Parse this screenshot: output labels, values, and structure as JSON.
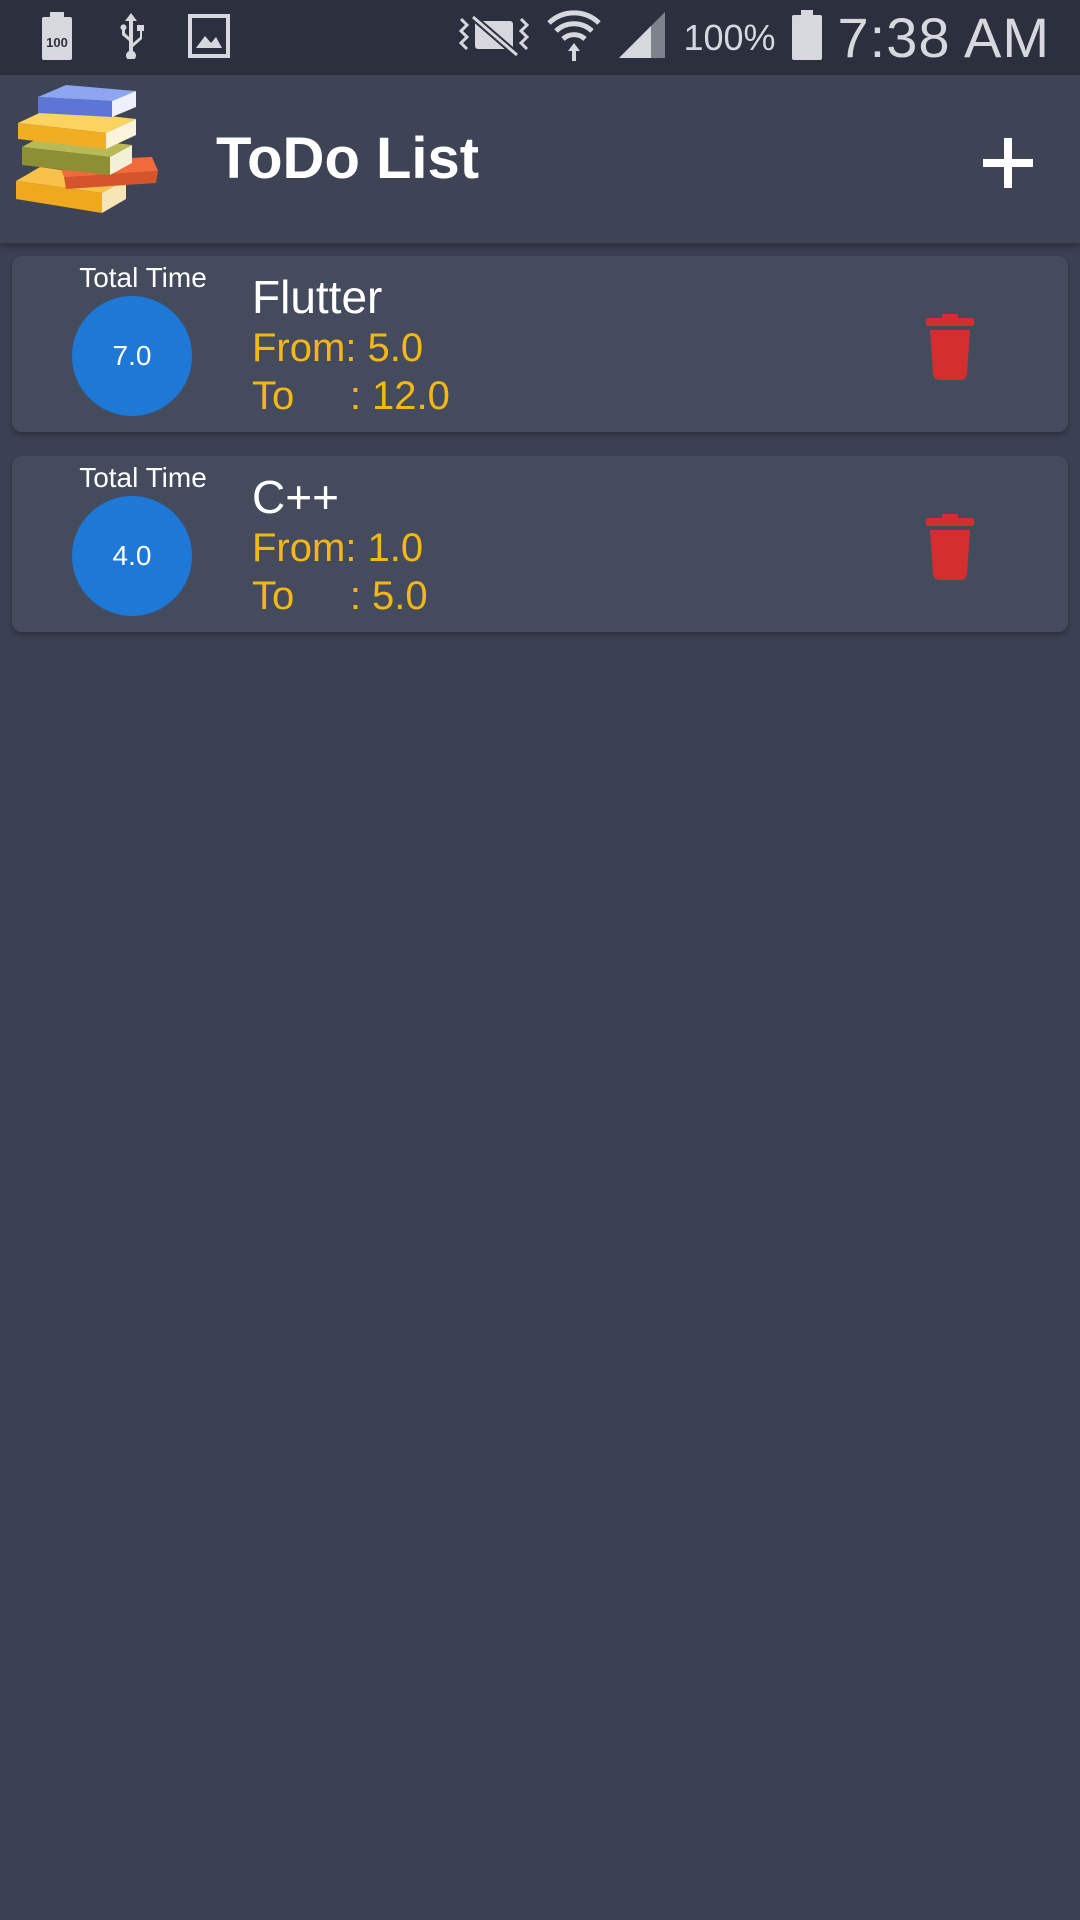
{
  "status_bar": {
    "battery_badge": "100",
    "battery_percent": "100%",
    "time": "7:38 AM",
    "icons": [
      "battery-saver-icon",
      "usb-icon",
      "image-icon",
      "mute-icon",
      "wifi-icon",
      "signal-icon",
      "battery-icon"
    ]
  },
  "app_bar": {
    "title": "ToDo List",
    "logo": "books-logo",
    "add_icon": "plus-icon"
  },
  "tasks": [
    {
      "total_label": "Total Time",
      "total": "7.0",
      "name": "Flutter",
      "from": "From: 5.0",
      "to": "To     : 12.0"
    },
    {
      "total_label": "Total Time",
      "total": "4.0",
      "name": "C++",
      "from": "From: 1.0",
      "to": "To     : 5.0"
    }
  ],
  "colors": {
    "background": "#3b4052",
    "app_bar": "#3e4456",
    "card": "#444b5d",
    "circle": "#1e78d6",
    "accent_text": "#f5b715",
    "delete": "#d32f2f"
  }
}
